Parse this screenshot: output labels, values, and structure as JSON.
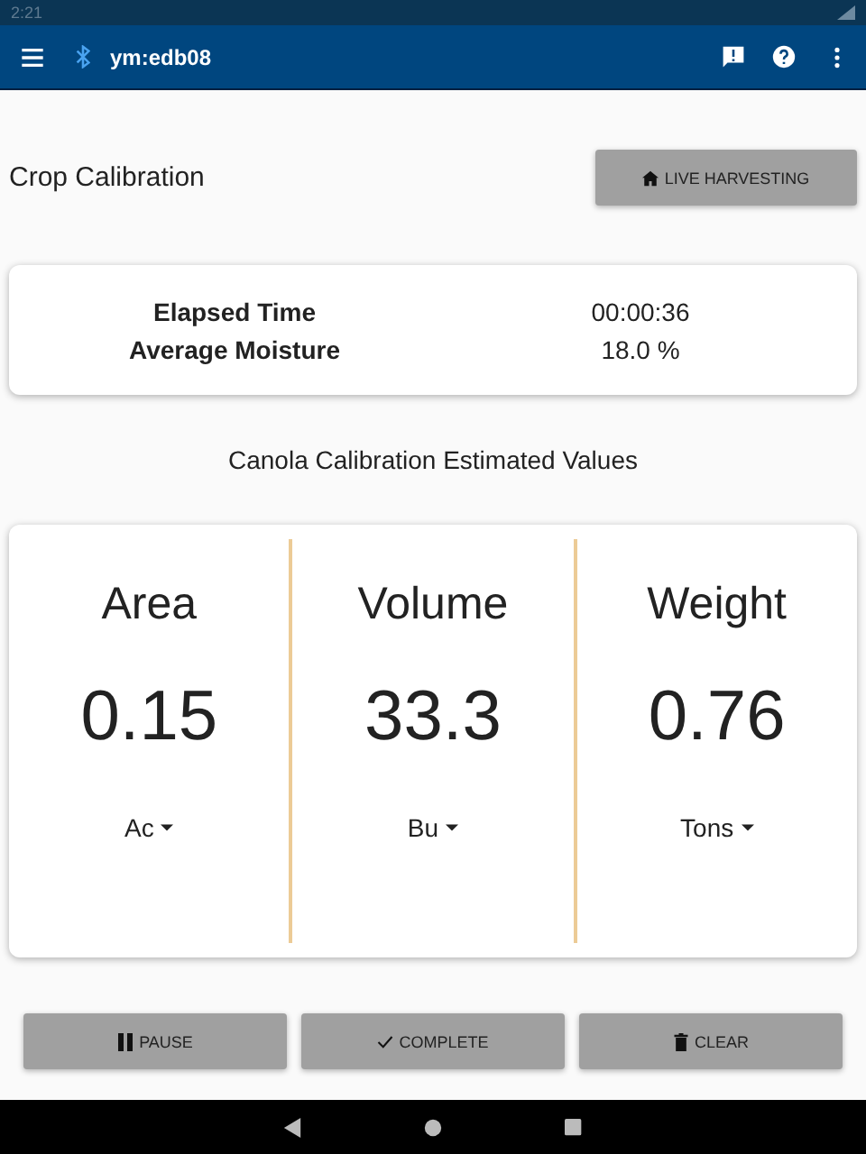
{
  "status_bar": {
    "time": "2:21"
  },
  "app_bar": {
    "device": "ym:edb08"
  },
  "header": {
    "title": "Crop Calibration",
    "button": {
      "label": "LIVE HARVESTING",
      "kind": "home"
    }
  },
  "summary": [
    {
      "label": "Elapsed Time",
      "value": "00:00:36"
    },
    {
      "label": "Average Moisture",
      "value": "18.0 %"
    }
  ],
  "estimates_title": "Canola Calibration Estimated Values",
  "estimates": [
    {
      "name": "Area",
      "value": "0.15",
      "unit": "Ac"
    },
    {
      "name": "Volume",
      "value": "33.3",
      "unit": "Bu"
    },
    {
      "name": "Weight",
      "value": "0.76",
      "unit": "Tons"
    }
  ],
  "buttons": [
    {
      "label": "PAUSE",
      "kind": "pause"
    },
    {
      "label": "COMPLETE",
      "kind": "check"
    },
    {
      "label": "CLEAR",
      "kind": "trash"
    }
  ]
}
